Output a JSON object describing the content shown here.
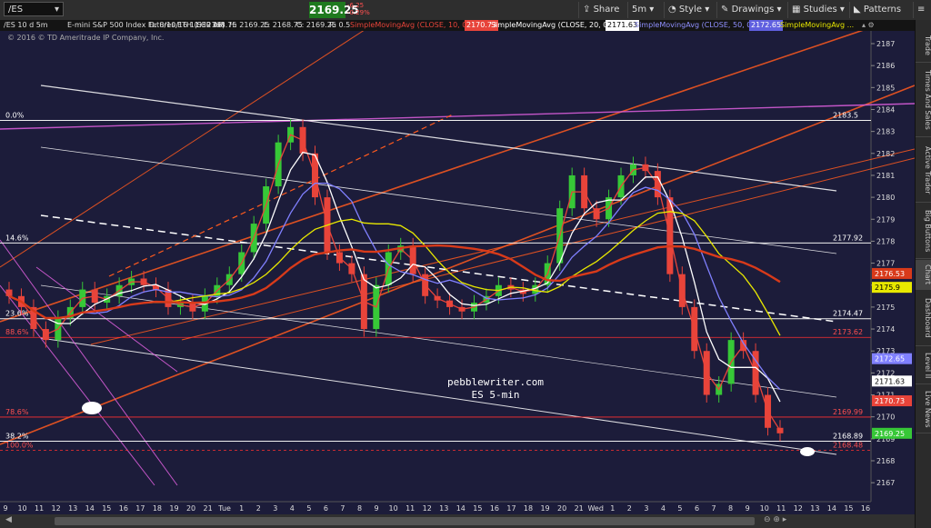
{
  "toolbar": {
    "symbol": "/ES",
    "last_price": "2169.25",
    "change": "-6.25",
    "change_pct": "-0.29%",
    "buttons": [
      "Share",
      "5m",
      "Style",
      "Drawings",
      "Studies",
      "Patterns"
    ]
  },
  "infobar": {
    "period": "/ES 10 d 5m",
    "description": "E-mini S&P 500 Index Futures,ETH (SEP 16)",
    "datetime": "D: 8/10/16 11:30 AM",
    "open": "O: 2168.75",
    "high": "H: 2169.25",
    "low": "L: 2168.75",
    "close": "C: 2169.25",
    "range": "R: 0.5",
    "sma10_label": "SimpleMovingAvg (CLOSE, 10, 0)",
    "sma10_value": "2170.73",
    "sma20_label": "SimpleMovingAvg (CLOSE, 20, 0)",
    "sma20_value": "2171.63",
    "sma50_label": "SimpleMovingAvg (CLOSE, 50, 0)",
    "sma50_value": "2172.65",
    "sma_extra_label": "SimpleMovingAvg ..."
  },
  "copyright": "© 2016 © TD Ameritrade IP Company, Inc.",
  "watermark": [
    "pebblewriter.com",
    "ES 5-min"
  ],
  "sidebar_tabs": [
    "Trade",
    "Times And Sales",
    "Active Trader",
    "Big Buttons",
    "Chart",
    "Dashboard",
    "Level II",
    "Live News"
  ],
  "colors": {
    "background": "#1c1c3a",
    "sma10": "#e8443a",
    "sma20": "#ffffff",
    "sma50": "#8080ff",
    "sma_yellow": "#e8e800",
    "sma_red": "#d83a1a",
    "up_candle": "#37c837",
    "down_candle": "#e8443a",
    "fib_line": "#f0f0f0",
    "channel_orange": "#ff5a1e",
    "magenta": "#e060e0"
  },
  "chart_data": {
    "type": "candlestick",
    "ylim": [
      2166,
      2188
    ],
    "y_ticks": [
      2167,
      2168,
      2169,
      2170,
      2171,
      2172,
      2173,
      2174,
      2175,
      2176,
      2177,
      2178,
      2179,
      2180,
      2181,
      2182,
      2183,
      2184,
      2185,
      2186,
      2187
    ],
    "x_ticks": [
      "9",
      "10",
      "11",
      "12",
      "13",
      "14",
      "15",
      "16",
      "17",
      "18",
      "19",
      "20",
      "21",
      "Tue",
      "1",
      "2",
      "3",
      "4",
      "5",
      "6",
      "7",
      "8",
      "9",
      "10",
      "11",
      "12",
      "13",
      "14",
      "15",
      "16",
      "17",
      "18",
      "19",
      "20",
      "21",
      "Wed",
      "1",
      "2",
      "3",
      "4",
      "5",
      "6",
      "7",
      "8",
      "9",
      "10",
      "11",
      "12",
      "13",
      "14",
      "15",
      "16"
    ],
    "fib_levels": [
      {
        "label": "0.0%",
        "value": 2183.5,
        "tag": "2183.5"
      },
      {
        "label": "14.6%",
        "value": 2177.92,
        "tag": "2177.92"
      },
      {
        "label": "23.6%",
        "value": 2174.47,
        "tag": "2174.47"
      },
      {
        "label": "38.2%",
        "value": 2168.89,
        "tag": "2168.89"
      }
    ],
    "fib_levels_red": [
      {
        "label": "88.6%",
        "value": 2173.62,
        "tag": "2173.62"
      },
      {
        "label": "78.6%",
        "value": 2169.99,
        "tag": "2169.99"
      },
      {
        "label": "100.0%",
        "value": 2168.48,
        "tag": "2168.48"
      }
    ],
    "price_tags": [
      {
        "value": 2176.53,
        "text": "2176.53",
        "color": "#d83a1a"
      },
      {
        "value": 2175.9,
        "text": "2175.9",
        "color": "#e8e800"
      },
      {
        "value": 2172.65,
        "text": "2172.65",
        "color": "#8080ff"
      },
      {
        "value": 2171.63,
        "text": "2171.63",
        "color": "#ffffff"
      },
      {
        "value": 2170.73,
        "text": "2170.73",
        "color": "#e8443a"
      },
      {
        "value": 2169.25,
        "text": "2169.25",
        "color": "#37c837"
      }
    ],
    "series": [
      {
        "name": "close",
        "values": [
          2175.5,
          2175.0,
          2174.0,
          2173.5,
          2174.5,
          2175.0,
          2175.8,
          2175.2,
          2175.5,
          2176.0,
          2176.3,
          2176.0,
          2175.8,
          2175.0,
          2175.2,
          2174.8,
          2175.5,
          2176.0,
          2176.5,
          2177.5,
          2178.8,
          2180.5,
          2182.5,
          2183.2,
          2182.0,
          2180.0,
          2177.5,
          2177.0,
          2176.5,
          2174.0,
          2176.0,
          2177.5,
          2177.8,
          2176.5,
          2175.5,
          2175.3,
          2175.0,
          2174.8,
          2175.2,
          2175.5,
          2176.0,
          2175.8,
          2175.6,
          2176.0,
          2177.0,
          2179.5,
          2181.0,
          2179.5,
          2179.0,
          2180.0,
          2181.0,
          2181.5,
          2181.2,
          2180.0,
          2176.5,
          2175.0,
          2173.0,
          2171.0,
          2171.5,
          2173.5,
          2173.0,
          2171.0,
          2169.5,
          2169.25
        ]
      }
    ]
  }
}
